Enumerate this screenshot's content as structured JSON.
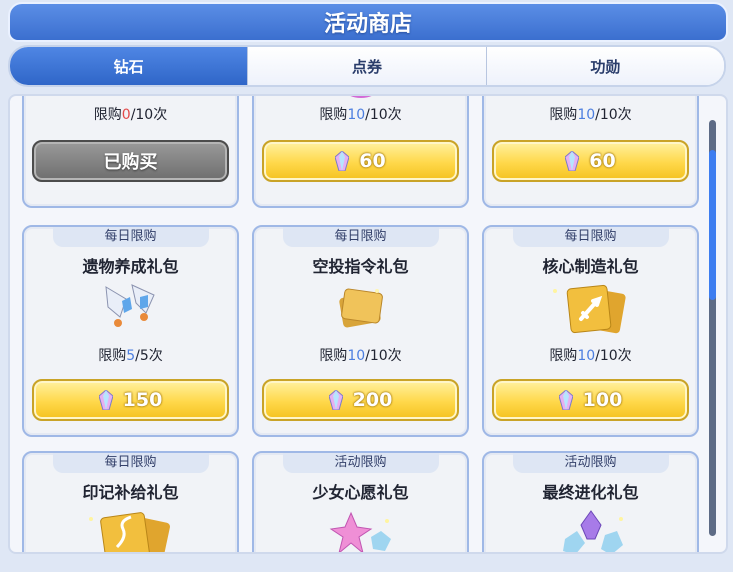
{
  "header": {
    "title": "活动商店"
  },
  "tabs": [
    {
      "label": "钻石",
      "active": true
    },
    {
      "label": "点券",
      "active": false
    },
    {
      "label": "功勋",
      "active": false
    }
  ],
  "row1": [
    {
      "limit_prefix": "限购",
      "limit_bought": "0",
      "limit_suffix": "/10次",
      "bought_color": "red",
      "button": "已购买",
      "sold_out": true,
      "icon": "wrench-item-icon"
    },
    {
      "limit_prefix": "限购",
      "limit_bought": "10",
      "limit_suffix": "/10次",
      "bought_color": "blue",
      "price": "60",
      "icon": "pink-crystal-icon"
    },
    {
      "limit_prefix": "限购",
      "limit_bought": "10",
      "limit_suffix": "/10次",
      "bought_color": "blue",
      "price": "60",
      "icon": "blue-crystal-icon"
    }
  ],
  "row2": [
    {
      "tag": "每日限购",
      "name": "遗物养成礼包",
      "limit_prefix": "限购",
      "limit_bought": "5",
      "limit_suffix": "/5次",
      "price": "150",
      "icon": "winged-relic-icon"
    },
    {
      "tag": "每日限购",
      "name": "空投指令礼包",
      "limit_prefix": "限购",
      "limit_bought": "10",
      "limit_suffix": "/10次",
      "price": "200",
      "icon": "gold-cards-icon"
    },
    {
      "tag": "每日限购",
      "name": "核心制造礼包",
      "limit_prefix": "限购",
      "limit_bought": "10",
      "limit_suffix": "/10次",
      "price": "100",
      "icon": "sword-cards-icon"
    }
  ],
  "row3": [
    {
      "tag": "每日限购",
      "name": "印记补给礼包",
      "icon": "dna-cards-icon"
    },
    {
      "tag": "活动限购",
      "name": "少女心愿礼包",
      "icon": "star-crystal-icon"
    },
    {
      "tag": "活动限购",
      "name": "最终进化礼包",
      "icon": "evolution-crystal-icon"
    }
  ],
  "colors": {
    "accent": "#3b6fcf",
    "count_blue": "#4d7fe0",
    "count_red": "#e34a4a",
    "price_gold": "#ffd84a",
    "sold_gray": "#7a7a7a"
  }
}
